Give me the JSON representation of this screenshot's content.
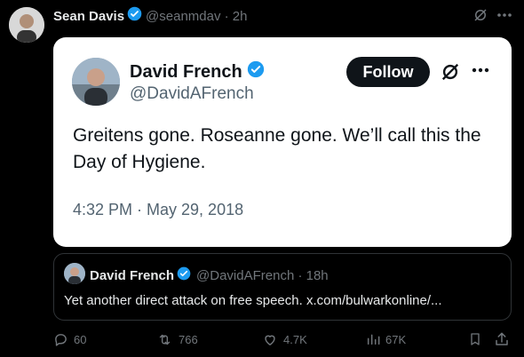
{
  "header": {
    "name": "Sean Davis",
    "handle_time": "@seanmdav · 2h"
  },
  "card": {
    "name": "David French",
    "handle": "@DavidAFrench",
    "follow_label": "Follow",
    "text": "Greitens gone. Roseanne gone. We’ll call this the Day of Hygiene.",
    "timestamp": "4:32 PM · May 29, 2018"
  },
  "quote": {
    "name": "David French",
    "handle_time": "@DavidAFrench · 18h",
    "text": "Yet another direct attack on free speech. x.com/bulwarkonline/..."
  },
  "actions": {
    "replies": "60",
    "reposts": "766",
    "likes": "4.7K",
    "views": "67K"
  },
  "colors": {
    "verified": "#1d9bf0",
    "background": "#000000",
    "muted": "#71767b",
    "card": "#ffffff"
  },
  "icons": [
    "verified-badge-icon",
    "grok-icon",
    "more-icon",
    "reply-icon",
    "repost-icon",
    "like-icon",
    "views-icon",
    "bookmark-icon",
    "share-icon"
  ]
}
